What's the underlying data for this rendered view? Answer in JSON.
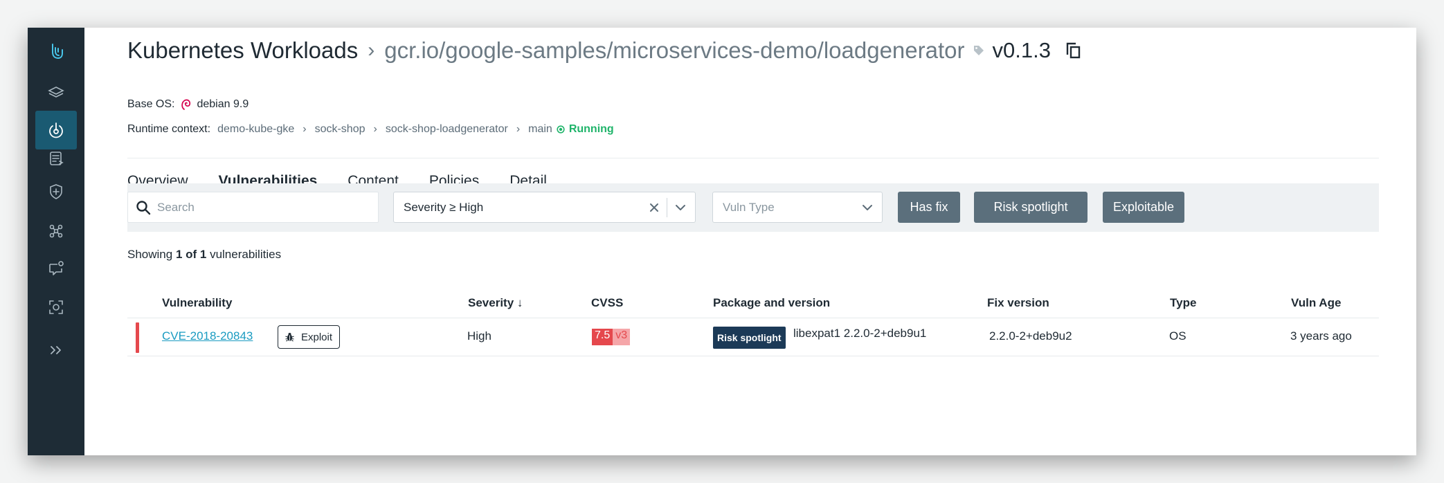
{
  "header": {
    "title": "Kubernetes Workloads",
    "image": "gcr.io/google-samples/microservices-demo/loadgenerator",
    "tag": "v0.1.3"
  },
  "base_os": {
    "label": "Base OS:",
    "value": "debian 9.9"
  },
  "runtime": {
    "label": "Runtime context:",
    "crumbs": [
      "demo-kube-gke",
      "sock-shop",
      "sock-shop-loadgenerator",
      "main"
    ],
    "status": "Running"
  },
  "tabs": [
    {
      "label": "Overview",
      "active": false
    },
    {
      "label": "Vulnerabilities",
      "active": true
    },
    {
      "label": "Content",
      "active": false
    },
    {
      "label": "Policies",
      "active": false
    },
    {
      "label": "Detail",
      "active": false
    }
  ],
  "filters": {
    "search_placeholder": "Search",
    "severity_value": "Severity ≥ High",
    "vuln_type_placeholder": "Vuln Type",
    "has_fix": "Has fix",
    "risk_spotlight": "Risk spotlight",
    "exploitable": "Exploitable"
  },
  "summary": {
    "prefix": "Showing ",
    "count": "1 of 1",
    "suffix": " vulnerabilities"
  },
  "table": {
    "headers": {
      "vulnerability": "Vulnerability",
      "severity": "Severity ↓",
      "cvss": "CVSS",
      "package": "Package and version",
      "fix": "Fix version",
      "type": "Type",
      "age": "Vuln Age"
    },
    "rows": [
      {
        "cve": "CVE-2018-20843",
        "exploit_badge": "Exploit",
        "severity": "High",
        "cvss_score": "7.5",
        "cvss_version": "v3",
        "risk_badge": "Risk spotlight",
        "package": "libexpat1 2.2.0-2+deb9u1",
        "fix_version": "2.2.0-2+deb9u2",
        "type": "OS",
        "age": "3 years ago"
      }
    ]
  },
  "colors": {
    "sidebar": "#1e2c36",
    "sidebar_active": "#1a5a72",
    "accent_link": "#1a9bc1",
    "running_green": "#1fb46a",
    "critical_red": "#e5484d",
    "button_gray": "#5b6f7c",
    "risk_badge_navy": "#1c3a57"
  },
  "sidebar_icons": [
    "logo-icon",
    "layers-icon",
    "radar-icon",
    "report-icon",
    "shield-plus-icon",
    "network-icon",
    "chat-settings-icon",
    "scan-icon",
    "expand-icon"
  ]
}
